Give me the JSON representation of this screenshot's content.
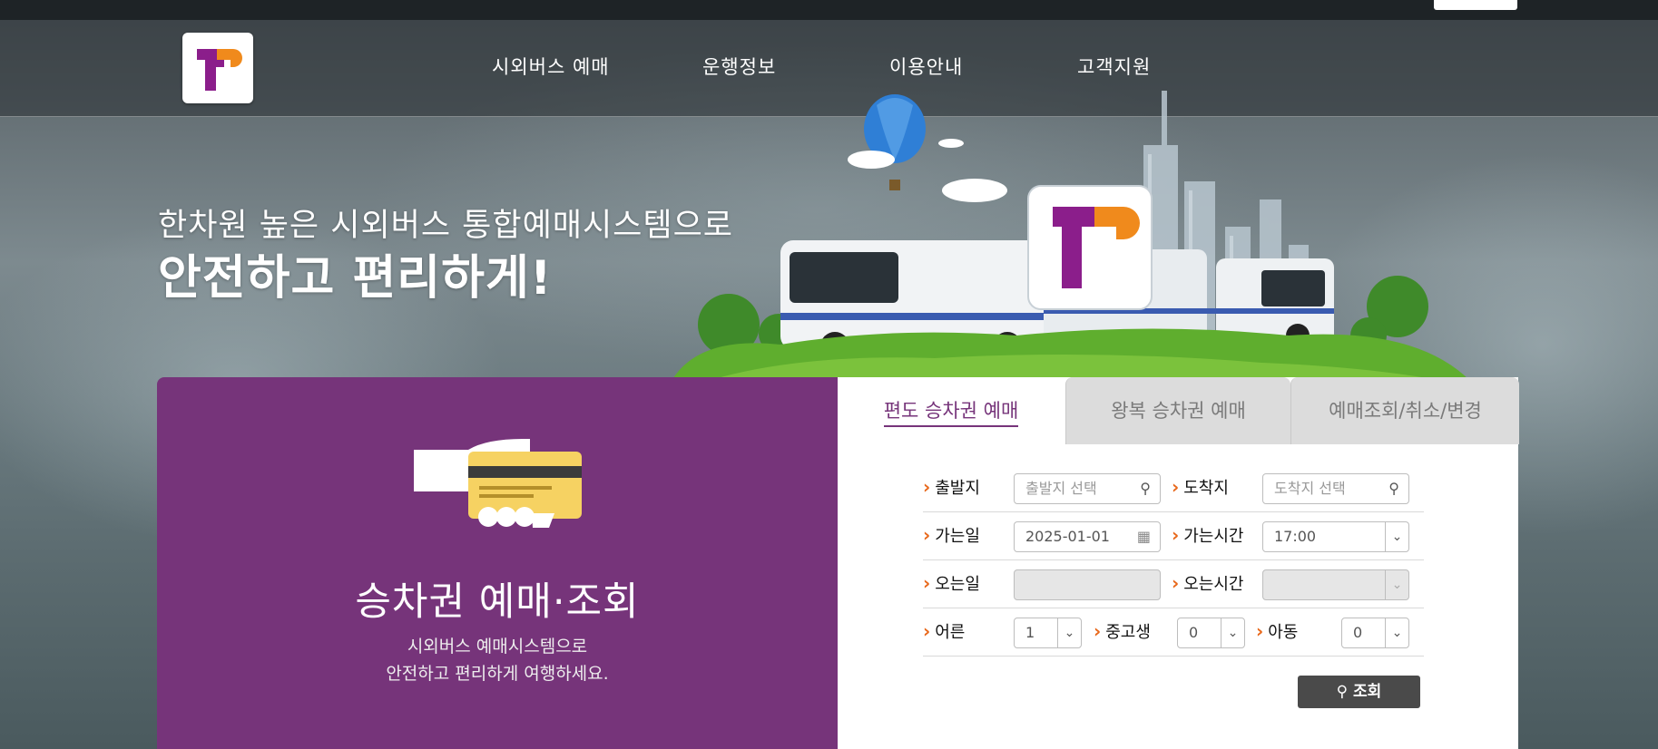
{
  "nav": {
    "items": [
      "시외버스 예매",
      "운행정보",
      "이용안내",
      "고객지원"
    ]
  },
  "hero": {
    "line1": "한차원 높은 시외버스 통합예매시스템으로",
    "line2": "안전하고 편리하게!"
  },
  "promo": {
    "title": "승차권 예매·조회",
    "sub1": "시외버스 예매시스템으로",
    "sub2": "안전하고 편리하게 여행하세요."
  },
  "tabs": [
    "편도 승차권 예매",
    "왕복 승차권 예매",
    "예매조회/취소/변경"
  ],
  "form": {
    "departure_label": "출발지",
    "departure_placeholder": "출발지 선택",
    "arrival_label": "도착지",
    "arrival_placeholder": "도착지 선택",
    "go_date_label": "가는일",
    "go_date_value": "2025-01-01",
    "go_time_label": "가는시간",
    "go_time_value": "17:00",
    "return_date_label": "오는일",
    "return_time_label": "오는시간",
    "adult_label": "어른",
    "adult_value": "1",
    "youth_label": "중고생",
    "youth_value": "0",
    "child_label": "아동",
    "child_value": "0",
    "search_label": "조회"
  },
  "colors": {
    "brand_purple": "#76347a",
    "brand_orange": "#f08a1c",
    "bullet_orange": "#e8681b"
  }
}
